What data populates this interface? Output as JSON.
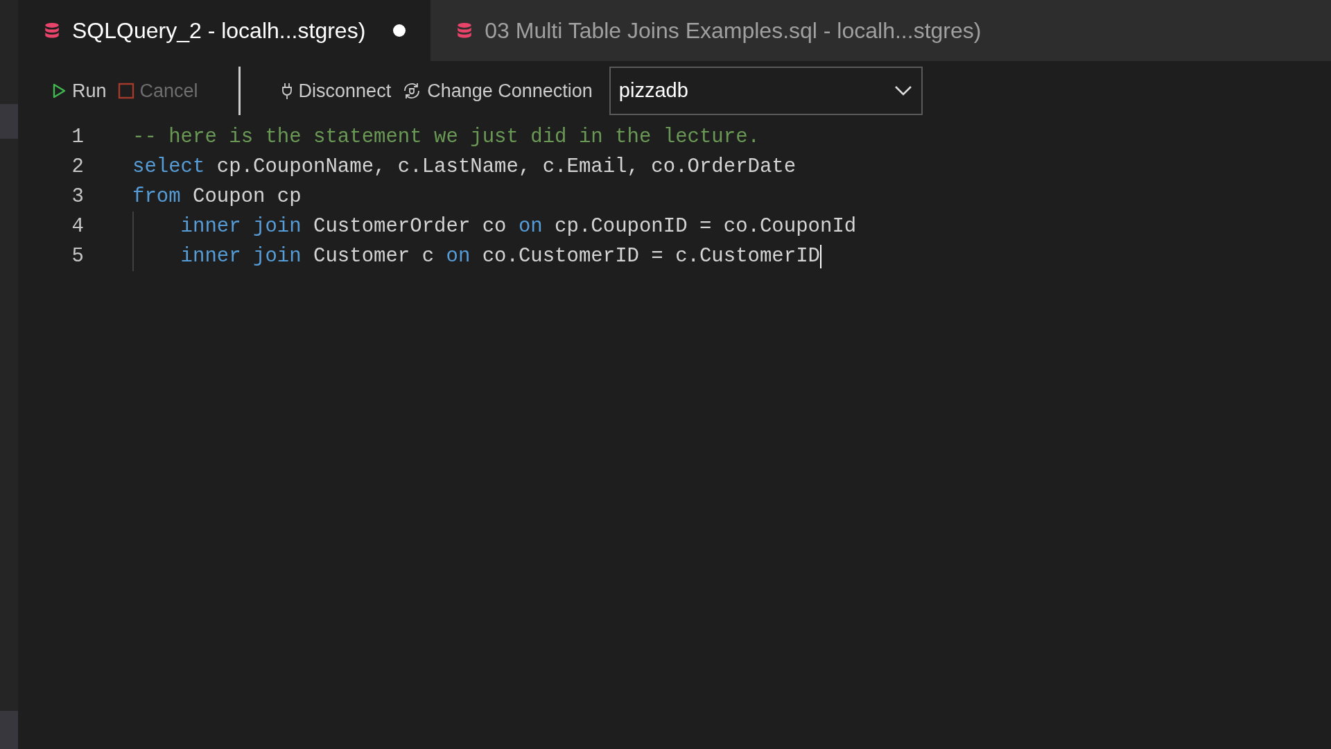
{
  "tabs": [
    {
      "label": "SQLQuery_2 - localh...stgres)",
      "selected": true,
      "modified": true
    },
    {
      "label": "03 Multi Table Joins Examples.sql - localh...stgres)",
      "selected": false,
      "modified": false
    }
  ],
  "toolbar": [
    {
      "kind": "run",
      "label": "Run",
      "disabled": false
    },
    {
      "kind": "cancel",
      "label": "Cancel",
      "disabled": true
    },
    {
      "kind": "disconnect",
      "label": "Disconnect",
      "disabled": false
    },
    {
      "kind": "connection",
      "label": "Change Connection",
      "disabled": false
    }
  ],
  "database": {
    "value": "pizzadb"
  },
  "lines": [
    {
      "number": "1",
      "cursor": false,
      "tokens": [
        {
          "kind": "comment",
          "text": "-- here is the statement we just did in the lecture."
        }
      ]
    },
    {
      "number": "2",
      "cursor": false,
      "tokens": [
        {
          "kind": "keyword",
          "text": "select"
        },
        {
          "kind": "plain",
          "text": " cp.CouponName, c.LastName, c.Email, co.OrderDate"
        }
      ]
    },
    {
      "number": "3",
      "cursor": false,
      "tokens": [
        {
          "kind": "keyword",
          "text": "from"
        },
        {
          "kind": "plain",
          "text": " Coupon cp"
        }
      ]
    },
    {
      "number": "4",
      "cursor": false,
      "tokens": [
        {
          "kind": "keyword",
          "text": "    inner join"
        },
        {
          "kind": "plain",
          "text": " CustomerOrder co "
        },
        {
          "kind": "keyword",
          "text": "on"
        },
        {
          "kind": "plain",
          "text": " cp.CouponID = co.CouponId"
        }
      ]
    },
    {
      "number": "5",
      "cursor": true,
      "tokens": [
        {
          "kind": "keyword",
          "text": "    inner join"
        },
        {
          "kind": "plain",
          "text": " Customer c "
        },
        {
          "kind": "keyword",
          "text": "on"
        },
        {
          "kind": "plain",
          "text": " co.CustomerID = c.CustomerID"
        }
      ]
    }
  ]
}
